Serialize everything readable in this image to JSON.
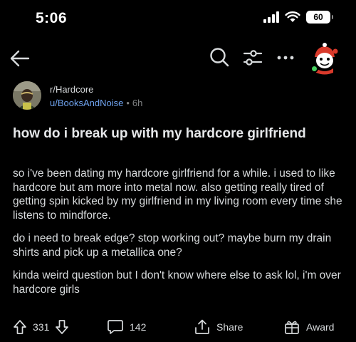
{
  "status_bar": {
    "time": "5:06",
    "battery": "60"
  },
  "nav": {
    "icons": [
      "back-arrow-icon",
      "search-icon",
      "sort-filter-icon",
      "more-icon",
      "avatar"
    ]
  },
  "post": {
    "subreddit": "r/Hardcore",
    "author": "u/BooksAndNoise",
    "separator": "•",
    "age": "6h",
    "title": "how do i break up with my hardcore girlfriend",
    "paragraphs": [
      "so i've been dating my hardcore girlfriend for a while. i used to like hardcore but am more into metal now. also getting really tired of getting spin kicked by my girlfriend in my living room every time she listens to mindforce.",
      "do i need to break edge? stop working out? maybe burn my drain shirts and pick up a metallica one?",
      "kinda weird question but I don't know where else to ask lol, i'm over hardcore girls"
    ]
  },
  "actions": {
    "vote_count": "331",
    "comment_count": "142",
    "share_label": "Share",
    "award_label": "Award"
  },
  "colors": {
    "background": "#000000",
    "text": "#d7dadc",
    "username": "#6fa3ef",
    "muted": "#818384",
    "online": "#46d160"
  }
}
